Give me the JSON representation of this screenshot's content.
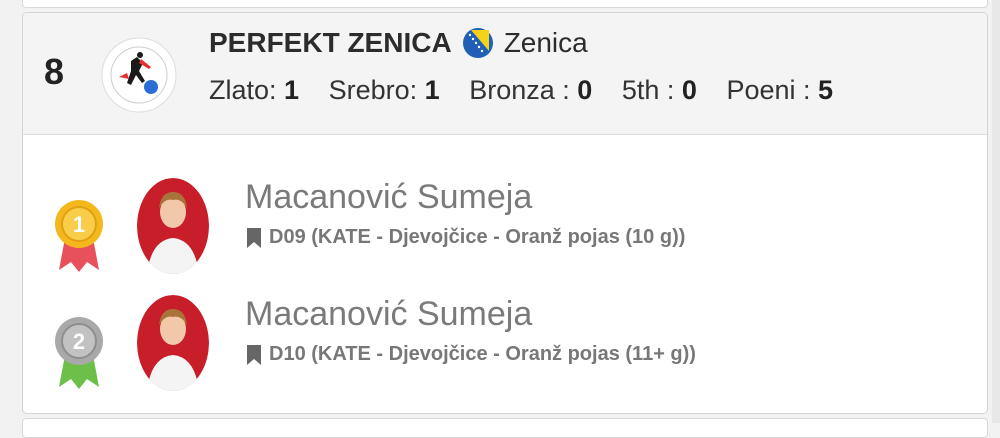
{
  "club": {
    "rank": "8",
    "name": "PERFEKT ZENICA",
    "city": "Zenica",
    "logo_icon": "karate-club-perfekt-zenica-logo",
    "flag_icon": "bosnia-herzegovina-flag",
    "stats": [
      {
        "label": "Zlato:",
        "value": "1"
      },
      {
        "label": "Srebro:",
        "value": "1"
      },
      {
        "label": "Bronza :",
        "value": "0"
      },
      {
        "label": "5th :",
        "value": "0"
      },
      {
        "label": "Poeni :",
        "value": "5"
      }
    ]
  },
  "results": [
    {
      "medal": "1",
      "medal_icon": "gold-medal-icon",
      "name": "Macanović Sumeja",
      "category": "D09 (KATE - Djevojčice - Oranž pojas (10 g))"
    },
    {
      "medal": "2",
      "medal_icon": "silver-medal-icon",
      "name": "Macanović Sumeja",
      "category": "D10 (KATE - Djevojčice - Oranž pojas (11+ g))"
    }
  ],
  "colors": {
    "gold": "#f5b81c",
    "silver": "#a9a9a9",
    "ribbon_gold": "#e8505b",
    "ribbon_silver": "#6cc04a",
    "flag_blue": "#1f5fb5",
    "flag_yellow": "#f7d21a"
  }
}
